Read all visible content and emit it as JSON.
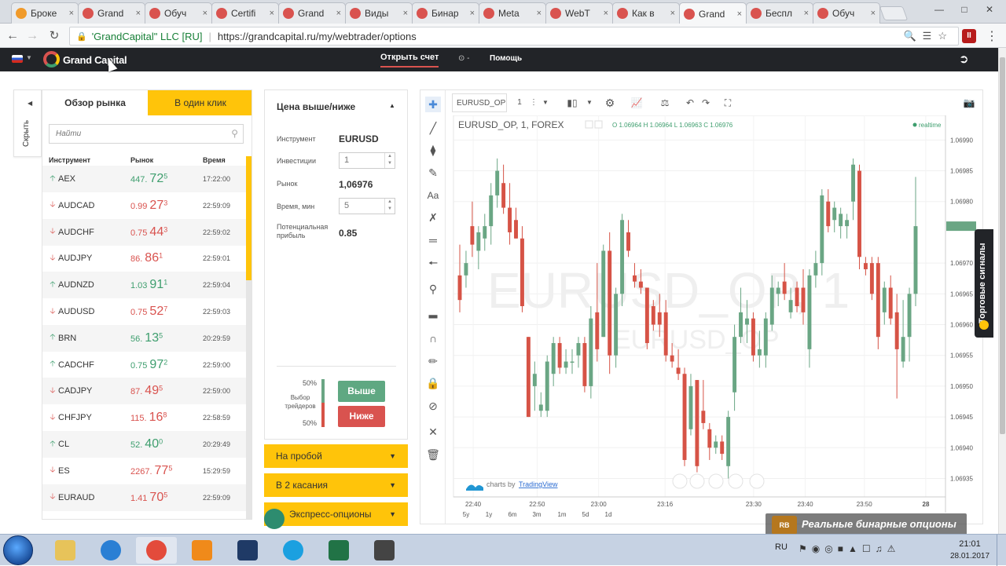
{
  "browser": {
    "tabs": [
      {
        "label": "Броке",
        "color": "#f09a2a"
      },
      {
        "label": "Grand",
        "color": "#d9534f"
      },
      {
        "label": "Обуч",
        "color": "#d9534f"
      },
      {
        "label": "Certifi",
        "color": "#d9534f"
      },
      {
        "label": "Grand",
        "color": "#d9534f"
      },
      {
        "label": "Виды",
        "color": "#d9534f"
      },
      {
        "label": "Бинар",
        "color": "#d9534f"
      },
      {
        "label": "Meta",
        "color": "#d9534f"
      },
      {
        "label": "WebT",
        "color": "#d9534f"
      },
      {
        "label": "Как в",
        "color": "#d9534f"
      },
      {
        "label": "Grand",
        "color": "#d9534f"
      },
      {
        "label": "Беспл",
        "color": "#d9534f"
      },
      {
        "label": "Обуч",
        "color": "#d9534f"
      }
    ],
    "close_glyph": "×",
    "secure_label": "'GrandCapital\" LLC [RU]",
    "url": "https://grandcapital.ru/my/webtrader/options",
    "account_letter": "II"
  },
  "topnav": {
    "brand": "Grand Capital",
    "open_account": "Открыть счет",
    "help": "Помощь",
    "clock_label": "⊙ -"
  },
  "sidebar": {
    "hide_label": "Скрыть",
    "tabs": [
      "Обзор рынка",
      "В один клик"
    ],
    "search_placeholder": "Найти",
    "columns": [
      "Инструмент",
      "Рынок",
      "Время"
    ],
    "rows": [
      {
        "dir": "up",
        "instrument": "AEX",
        "price_small": "447.",
        "price_big": "72",
        "price_sup": "5",
        "time": "17:22:00"
      },
      {
        "dir": "down",
        "instrument": "AUDCAD",
        "price_small": "0.99",
        "price_big": "27",
        "price_sup": "3",
        "time": "22:59:09"
      },
      {
        "dir": "down",
        "instrument": "AUDCHF",
        "price_small": "0.75",
        "price_big": "44",
        "price_sup": "3",
        "time": "22:59:02"
      },
      {
        "dir": "down",
        "instrument": "AUDJPY",
        "price_small": "86.",
        "price_big": "86",
        "price_sup": "1",
        "time": "22:59:01"
      },
      {
        "dir": "up",
        "instrument": "AUDNZD",
        "price_small": "1.03",
        "price_big": "91",
        "price_sup": "1",
        "time": "22:59:04"
      },
      {
        "dir": "down",
        "instrument": "AUDUSD",
        "price_small": "0.75",
        "price_big": "52",
        "price_sup": "7",
        "time": "22:59:03"
      },
      {
        "dir": "up",
        "instrument": "BRN",
        "price_small": "56.",
        "price_big": "13",
        "price_sup": "5",
        "time": "20:29:59"
      },
      {
        "dir": "up",
        "instrument": "CADCHF",
        "price_small": "0.75",
        "price_big": "97",
        "price_sup": "2",
        "time": "22:59:00"
      },
      {
        "dir": "down",
        "instrument": "CADJPY",
        "price_small": "87.",
        "price_big": "49",
        "price_sup": "5",
        "time": "22:59:00"
      },
      {
        "dir": "down",
        "instrument": "CHFJPY",
        "price_small": "115.",
        "price_big": "16",
        "price_sup": "8",
        "time": "22:58:59"
      },
      {
        "dir": "up",
        "instrument": "CL",
        "price_small": "52.",
        "price_big": "40",
        "price_sup": "0",
        "time": "20:29:49"
      },
      {
        "dir": "down",
        "instrument": "ES",
        "price_small": "2267.",
        "price_big": "77",
        "price_sup": "5",
        "time": "15:29:59"
      },
      {
        "dir": "down",
        "instrument": "EURAUD",
        "price_small": "1.41",
        "price_big": "70",
        "price_sup": "5",
        "time": "22:59:09"
      }
    ]
  },
  "option_panel": {
    "title": "Цена выше/ниже",
    "instrument_label": "Инструмент",
    "instrument_value": "EURUSD",
    "investment_label": "Инвестиции",
    "investment_value": "1",
    "market_label": "Рынок",
    "market_value": "1,06976",
    "time_label": "Время, мин",
    "time_value": "5",
    "profit_label": "Потенциальная прибыль",
    "profit_value": "0.85",
    "traders_label": "Выбор трейдеров",
    "up_pct": "50%",
    "down_pct": "50%",
    "up_button": "Выше",
    "down_button": "Ниже",
    "accordions": [
      "На пробой",
      "В 2 касания",
      "Экспресс-опционы"
    ]
  },
  "chart_toolbar": {
    "symbol": "EURUSD_OP",
    "interval": "1"
  },
  "chart_data": {
    "type": "candlestick",
    "title": "EURUSD_OP, 1, FOREX",
    "ohlc_label": "O 1.06964 H 1.06964 L 1.06963 C 1.06976",
    "realtime_label": "realtime",
    "watermark_big": "EURUSD_OP, 1",
    "watermark_small": "EURUSD_OP",
    "last_price": "1.06976",
    "y_ticks": [
      "1.06990",
      "1.06985",
      "1.06980",
      "1.06976",
      "1.06970",
      "1.06965",
      "1.06960",
      "1.06955",
      "1.06950",
      "1.06945",
      "1.06940",
      "1.06935"
    ],
    "y_range": [
      1.06932,
      1.06994
    ],
    "x_ticks": [
      "22:40",
      "22:50",
      "23:00",
      "23:16",
      "23:30",
      "23:40",
      "23:50",
      "28"
    ],
    "ranges": [
      "5y",
      "1y",
      "6m",
      "3m",
      "1m",
      "5d",
      "1d"
    ],
    "attribution_prefix": "charts by",
    "attribution_link": "TradingView",
    "candles": [
      {
        "o": 1.06968,
        "h": 1.06973,
        "l": 1.06962,
        "c": 1.06964,
        "up": false
      },
      {
        "o": 1.06968,
        "h": 1.06972,
        "l": 1.06966,
        "c": 1.0697,
        "up": true
      },
      {
        "o": 1.06976,
        "h": 1.0698,
        "l": 1.06971,
        "c": 1.06973,
        "up": false
      },
      {
        "o": 1.06972,
        "h": 1.06976,
        "l": 1.06969,
        "c": 1.06975,
        "up": true
      },
      {
        "o": 1.06974,
        "h": 1.06978,
        "l": 1.06972,
        "c": 1.06976,
        "up": true
      },
      {
        "o": 1.06976,
        "h": 1.06983,
        "l": 1.06973,
        "c": 1.06981,
        "up": true
      },
      {
        "o": 1.06981,
        "h": 1.06987,
        "l": 1.06979,
        "c": 1.06985,
        "up": true
      },
      {
        "o": 1.06983,
        "h": 1.06986,
        "l": 1.06978,
        "c": 1.06979,
        "up": false
      },
      {
        "o": 1.06979,
        "h": 1.06983,
        "l": 1.06973,
        "c": 1.06975,
        "up": false
      },
      {
        "o": 1.06977,
        "h": 1.06979,
        "l": 1.06974,
        "c": 1.06974,
        "up": false
      },
      {
        "o": 1.06974,
        "h": 1.06976,
        "l": 1.06962,
        "c": 1.06963,
        "up": false
      },
      {
        "o": 1.06958,
        "h": 1.06958,
        "l": 1.06945,
        "c": 1.06945,
        "up": false
      },
      {
        "o": 1.0695,
        "h": 1.06954,
        "l": 1.06946,
        "c": 1.06952,
        "up": true
      },
      {
        "o": 1.06946,
        "h": 1.06949,
        "l": 1.06945,
        "c": 1.06947,
        "up": true
      },
      {
        "o": 1.06946,
        "h": 1.06955,
        "l": 1.06945,
        "c": 1.06954,
        "up": true
      },
      {
        "o": 1.06952,
        "h": 1.06958,
        "l": 1.0695,
        "c": 1.06957,
        "up": true
      },
      {
        "o": 1.06957,
        "h": 1.06958,
        "l": 1.06952,
        "c": 1.06953,
        "up": false
      },
      {
        "o": 1.06954,
        "h": 1.06956,
        "l": 1.06952,
        "c": 1.06953,
        "up": true
      },
      {
        "o": 1.06954,
        "h": 1.06956,
        "l": 1.06952,
        "c": 1.06954,
        "up": true
      },
      {
        "o": 1.06955,
        "h": 1.06958,
        "l": 1.06953,
        "c": 1.06957,
        "up": true
      },
      {
        "o": 1.06957,
        "h": 1.06958,
        "l": 1.06949,
        "c": 1.0695,
        "up": false
      },
      {
        "o": 1.0695,
        "h": 1.06963,
        "l": 1.06948,
        "c": 1.06961,
        "up": true
      },
      {
        "o": 1.06962,
        "h": 1.0697,
        "l": 1.06954,
        "c": 1.06956,
        "up": false
      },
      {
        "o": 1.06958,
        "h": 1.06973,
        "l": 1.06958,
        "c": 1.06972,
        "up": true
      },
      {
        "o": 1.06972,
        "h": 1.06975,
        "l": 1.06952,
        "c": 1.06955,
        "up": false
      },
      {
        "o": 1.06955,
        "h": 1.06966,
        "l": 1.06953,
        "c": 1.06965,
        "up": true
      },
      {
        "o": 1.06965,
        "h": 1.06978,
        "l": 1.06963,
        "c": 1.06977,
        "up": true
      },
      {
        "o": 1.06975,
        "h": 1.06977,
        "l": 1.06971,
        "c": 1.06972,
        "up": false
      },
      {
        "o": 1.06968,
        "h": 1.0697,
        "l": 1.06966,
        "c": 1.06967,
        "up": false
      },
      {
        "o": 1.06967,
        "h": 1.06969,
        "l": 1.06965,
        "c": 1.06966,
        "up": false
      },
      {
        "o": 1.06966,
        "h": 1.06966,
        "l": 1.06956,
        "c": 1.06957,
        "up": false
      },
      {
        "o": 1.06963,
        "h": 1.06964,
        "l": 1.06959,
        "c": 1.0696,
        "up": false
      },
      {
        "o": 1.06962,
        "h": 1.06965,
        "l": 1.06958,
        "c": 1.0696,
        "up": false
      },
      {
        "o": 1.06962,
        "h": 1.06964,
        "l": 1.06954,
        "c": 1.06955,
        "up": false
      },
      {
        "o": 1.06955,
        "h": 1.06957,
        "l": 1.06953,
        "c": 1.06954,
        "up": false
      },
      {
        "o": 1.06953,
        "h": 1.06956,
        "l": 1.06951,
        "c": 1.06952,
        "up": false
      },
      {
        "o": 1.06952,
        "h": 1.06953,
        "l": 1.06937,
        "c": 1.06938,
        "up": false
      },
      {
        "o": 1.06943,
        "h": 1.06952,
        "l": 1.06942,
        "c": 1.0695,
        "up": true
      },
      {
        "o": 1.06951,
        "h": 1.06951,
        "l": 1.06936,
        "c": 1.06937,
        "up": false
      },
      {
        "o": 1.06946,
        "h": 1.06951,
        "l": 1.06943,
        "c": 1.06944,
        "up": false
      },
      {
        "o": 1.06943,
        "h": 1.06944,
        "l": 1.06938,
        "c": 1.0694,
        "up": false
      },
      {
        "o": 1.06941,
        "h": 1.06942,
        "l": 1.06939,
        "c": 1.0694,
        "up": true
      },
      {
        "o": 1.06941,
        "h": 1.06942,
        "l": 1.06938,
        "c": 1.06939,
        "up": false
      },
      {
        "o": 1.06937,
        "h": 1.06946,
        "l": 1.06935,
        "c": 1.06945,
        "up": true
      },
      {
        "o": 1.06949,
        "h": 1.0696,
        "l": 1.06946,
        "c": 1.06958,
        "up": true
      },
      {
        "o": 1.06958,
        "h": 1.06966,
        "l": 1.06957,
        "c": 1.06962,
        "up": true
      },
      {
        "o": 1.0696,
        "h": 1.06964,
        "l": 1.06957,
        "c": 1.06961,
        "up": true
      },
      {
        "o": 1.06961,
        "h": 1.06962,
        "l": 1.06954,
        "c": 1.06955,
        "up": false
      },
      {
        "o": 1.06955,
        "h": 1.06959,
        "l": 1.06953,
        "c": 1.06956,
        "up": true
      },
      {
        "o": 1.06955,
        "h": 1.06962,
        "l": 1.06953,
        "c": 1.06961,
        "up": true
      },
      {
        "o": 1.0696,
        "h": 1.06968,
        "l": 1.06959,
        "c": 1.06966,
        "up": true
      },
      {
        "o": 1.06965,
        "h": 1.06967,
        "l": 1.06963,
        "c": 1.06966,
        "up": true
      },
      {
        "o": 1.06967,
        "h": 1.0697,
        "l": 1.06964,
        "c": 1.06965,
        "up": false
      },
      {
        "o": 1.06962,
        "h": 1.06966,
        "l": 1.06961,
        "c": 1.06964,
        "up": true
      },
      {
        "o": 1.06966,
        "h": 1.06967,
        "l": 1.06962,
        "c": 1.06963,
        "up": false
      },
      {
        "o": 1.06966,
        "h": 1.06969,
        "l": 1.0696,
        "c": 1.06962,
        "up": false
      },
      {
        "o": 1.06956,
        "h": 1.06969,
        "l": 1.06953,
        "c": 1.06968,
        "up": true
      },
      {
        "o": 1.06968,
        "h": 1.06972,
        "l": 1.06966,
        "c": 1.0697,
        "up": true
      },
      {
        "o": 1.0697,
        "h": 1.06982,
        "l": 1.06968,
        "c": 1.06981,
        "up": true
      },
      {
        "o": 1.0698,
        "h": 1.06982,
        "l": 1.06975,
        "c": 1.06976,
        "up": false
      },
      {
        "o": 1.06977,
        "h": 1.0698,
        "l": 1.06975,
        "c": 1.06979,
        "up": true
      },
      {
        "o": 1.06976,
        "h": 1.06979,
        "l": 1.06974,
        "c": 1.06978,
        "up": true
      },
      {
        "o": 1.06976,
        "h": 1.06978,
        "l": 1.06974,
        "c": 1.06977,
        "up": true
      },
      {
        "o": 1.0698,
        "h": 1.06987,
        "l": 1.06977,
        "c": 1.06986,
        "up": true
      },
      {
        "o": 1.06985,
        "h": 1.06986,
        "l": 1.06969,
        "c": 1.06971,
        "up": false
      },
      {
        "o": 1.0697,
        "h": 1.06971,
        "l": 1.06968,
        "c": 1.06969,
        "up": false
      },
      {
        "o": 1.0697,
        "h": 1.06971,
        "l": 1.06964,
        "c": 1.06965,
        "up": false
      },
      {
        "o": 1.0697,
        "h": 1.06971,
        "l": 1.06956,
        "c": 1.06958,
        "up": false
      },
      {
        "o": 1.06962,
        "h": 1.06967,
        "l": 1.0696,
        "c": 1.06966,
        "up": true
      },
      {
        "o": 1.06966,
        "h": 1.06968,
        "l": 1.0696,
        "c": 1.06961,
        "up": false
      },
      {
        "o": 1.06962,
        "h": 1.06965,
        "l": 1.06948,
        "c": 1.06956,
        "up": false
      },
      {
        "o": 1.06954,
        "h": 1.06964,
        "l": 1.06953,
        "c": 1.06958,
        "up": true
      },
      {
        "o": 1.06958,
        "h": 1.06966,
        "l": 1.06954,
        "c": 1.06965,
        "up": true
      },
      {
        "o": 1.06965,
        "h": 1.06984,
        "l": 1.06963,
        "c": 1.06976,
        "up": true
      }
    ]
  },
  "signals_tab": "Торговые сигналы",
  "promo_watermark": "Реальные бинарные опционы",
  "promo_badge": "RB",
  "taskbar": {
    "lang": "RU",
    "time": "21:01",
    "date": "28.01.2017",
    "apps": [
      {
        "name": "explorer",
        "color": "#e7c35a"
      },
      {
        "name": "internet-explorer",
        "color": "#2a7fd4"
      },
      {
        "name": "chrome",
        "color": "#e34b3b"
      },
      {
        "name": "media-player",
        "color": "#f08a1a"
      },
      {
        "name": "photoshop",
        "color": "#1f3a66"
      },
      {
        "name": "skype",
        "color": "#1ba0e0"
      },
      {
        "name": "excel",
        "color": "#217346"
      },
      {
        "name": "app-tool",
        "color": "#444444"
      }
    ]
  },
  "colors": {
    "accent_yellow": "#ffc40a",
    "up_green": "#3e9e6e",
    "down_red": "#d9534f",
    "candle_up": "#6aa684",
    "candle_down": "#d65346",
    "nav_dark": "#222428"
  }
}
